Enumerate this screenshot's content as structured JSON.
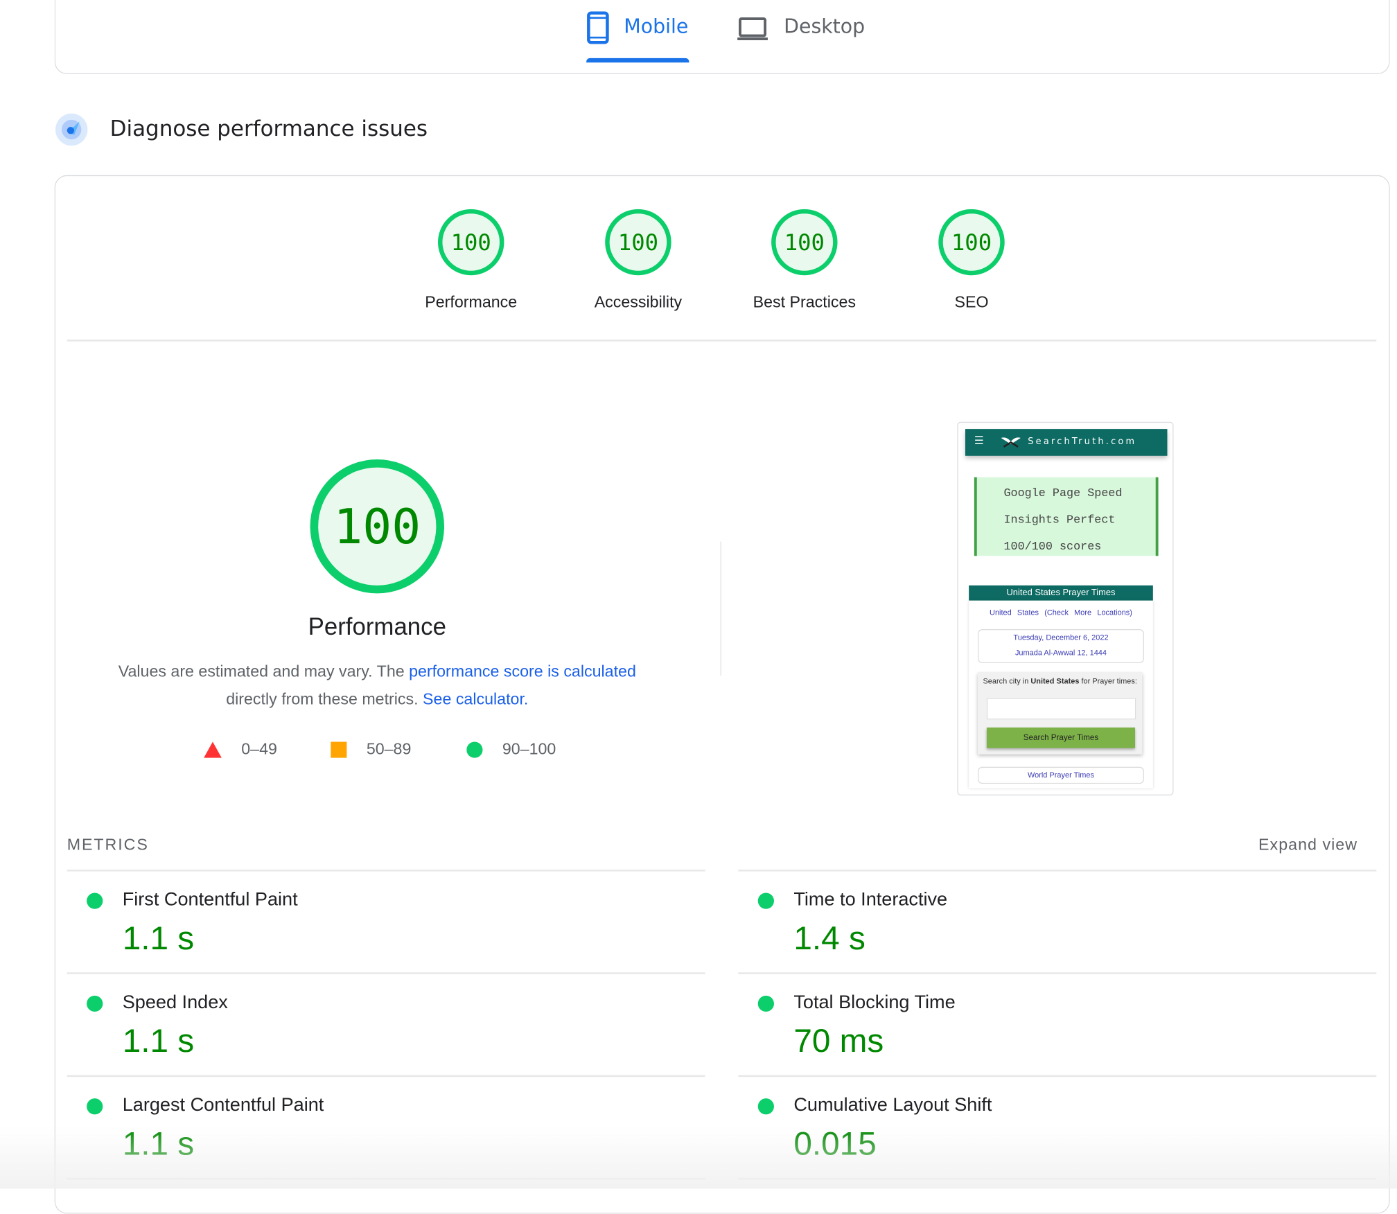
{
  "tabs": {
    "items": [
      {
        "label": "Mobile",
        "icon": "mobile-phone-icon",
        "active": true
      },
      {
        "label": "Desktop",
        "icon": "laptop-icon",
        "active": false
      }
    ],
    "accent": "#1a73e8"
  },
  "section": {
    "title": "Diagnose performance issues",
    "icon": "lighthouse-gauge-icon"
  },
  "categories": [
    {
      "label": "Performance",
      "score": "100"
    },
    {
      "label": "Accessibility",
      "score": "100"
    },
    {
      "label": "Best Practices",
      "score": "100"
    },
    {
      "label": "SEO",
      "score": "100"
    }
  ],
  "performance": {
    "score": "100",
    "title": "Performance",
    "desc_prefix": "Values are estimated and may vary. The ",
    "desc_link1": "performance score is calculated",
    "desc_middle": " directly from these metrics. ",
    "desc_link2": "See calculator."
  },
  "legend": [
    {
      "range": "0–49",
      "shape": "triangle",
      "color": "#ff3333"
    },
    {
      "range": "50–89",
      "shape": "square",
      "color": "#ffa400"
    },
    {
      "range": "90–100",
      "shape": "circle",
      "color": "#0cce6b"
    }
  ],
  "screenshot": {
    "brand": "SearchTruth.com",
    "banner_lines": [
      "Google Page Speed",
      "Insights Perfect",
      "100/100 scores"
    ],
    "bar_title": "United States Prayer Times",
    "location": "United States",
    "location_link": "(Check More Locations)",
    "date_gregorian": "Tuesday, December 6, 2022",
    "date_hijri": "Jumada Al-Awwal 12, 1444",
    "search_label_prefix": "Search city in ",
    "search_label_bold": "United States",
    "search_label_suffix": " for Prayer times:",
    "search_button": "Search Prayer Times",
    "world_link": "World Prayer Times"
  },
  "metrics": {
    "header": "METRICS",
    "expand_label": "Expand view",
    "good_color": "#0cce6b",
    "items": [
      {
        "name": "First Contentful Paint",
        "value": "1.1 s"
      },
      {
        "name": "Time to Interactive",
        "value": "1.4 s"
      },
      {
        "name": "Speed Index",
        "value": "1.1 s"
      },
      {
        "name": "Total Blocking Time",
        "value": "70 ms"
      },
      {
        "name": "Largest Contentful Paint",
        "value": "1.1 s"
      },
      {
        "name": "Cumulative Layout Shift",
        "value": "0.015"
      }
    ]
  }
}
